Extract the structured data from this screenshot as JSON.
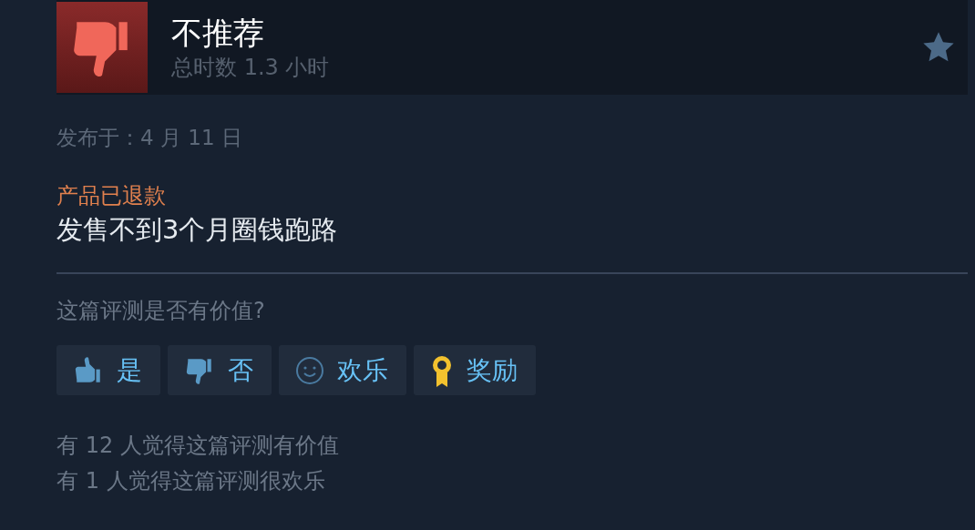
{
  "review": {
    "verdict": "不推荐",
    "recommended": false,
    "playtime": "总时数 1.3 小时",
    "posted": "发布于：4 月 11 日",
    "refund_note": "产品已退款",
    "body": "发售不到3个月圈钱跑路"
  },
  "helpful": {
    "question": "这篇评测是否有价值?",
    "buttons": [
      {
        "kind": "yes",
        "label": "是"
      },
      {
        "kind": "no",
        "label": "否"
      },
      {
        "kind": "funny",
        "label": "欢乐"
      },
      {
        "kind": "award",
        "label": "奖励"
      }
    ],
    "counts": [
      "有 12 人觉得这篇评测有价值",
      "有 1 人觉得这篇评测很欢乐"
    ]
  }
}
